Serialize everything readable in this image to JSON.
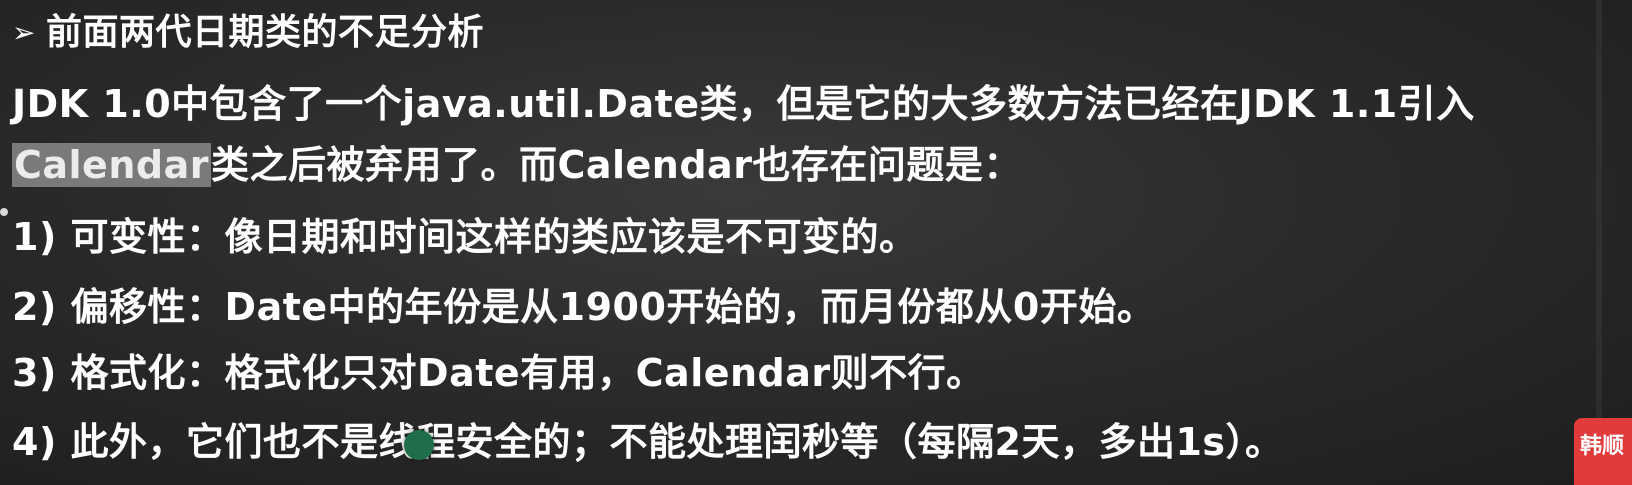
{
  "heading": {
    "bullet": "➢",
    "text": "前面两代日期类的不足分析"
  },
  "intro": {
    "line1": "JDK 1.0中包含了一个java.util.Date类，但是它的大多数方法已经在JDK 1.1引入",
    "line2_highlight": "Calendar",
    "line2_rest": "类之后被弃用了。而Calendar也存在问题是："
  },
  "points": [
    "1) 可变性：像日期和时间这样的类应该是不可变的。",
    "2) 偏移性：Date中的年份是从1900开始的，而月份都从0开始。",
    "3) 格式化：格式化只对Date有用，Calendar则不行。",
    "4) 此外，它们也不是线程安全的；不能处理闰秒等（每隔2天，多出1s）。"
  ],
  "watermark": {
    "text": "韩顺"
  },
  "colors": {
    "background": "#2b2b2b",
    "text": "#ffffff",
    "highlight": "#7a7a7a",
    "watermark": "#e23b3b",
    "cursor_dot": "#1f6e4a"
  }
}
